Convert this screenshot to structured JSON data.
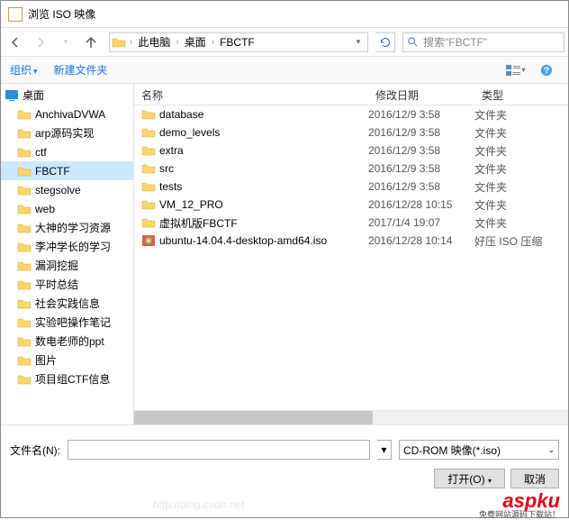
{
  "title": "浏览 ISO 映像",
  "breadcrumb": [
    "此电脑",
    "桌面",
    "FBCTF"
  ],
  "search_placeholder": "搜索\"FBCTF\"",
  "toolbar": {
    "organize": "组织",
    "new_folder": "新建文件夹"
  },
  "tree": {
    "root": "桌面",
    "items": [
      "AnchivaDVWA",
      "arp源码实现",
      "ctf",
      "FBCTF",
      "stegsolve",
      "web",
      "大神的学习资源",
      "李冲学长的学习",
      "漏洞挖掘",
      "平时总结",
      "社会实践信息",
      "实验吧操作笔记",
      "数电老师的ppt",
      "图片",
      "项目组CTF信息"
    ],
    "selected_index": 3
  },
  "file_columns": {
    "name": "名称",
    "date": "修改日期",
    "type": "类型"
  },
  "files": [
    {
      "name": "database",
      "date": "2016/12/9 3:58",
      "type": "文件夹",
      "icon": "folder"
    },
    {
      "name": "demo_levels",
      "date": "2016/12/9 3:58",
      "type": "文件夹",
      "icon": "folder"
    },
    {
      "name": "extra",
      "date": "2016/12/9 3:58",
      "type": "文件夹",
      "icon": "folder"
    },
    {
      "name": "src",
      "date": "2016/12/9 3:58",
      "type": "文件夹",
      "icon": "folder"
    },
    {
      "name": "tests",
      "date": "2016/12/9 3:58",
      "type": "文件夹",
      "icon": "folder"
    },
    {
      "name": "VM_12_PRO",
      "date": "2016/12/28 10:15",
      "type": "文件夹",
      "icon": "folder"
    },
    {
      "name": "虚拟机版FBCTF",
      "date": "2017/1/4 19:07",
      "type": "文件夹",
      "icon": "folder"
    },
    {
      "name": "ubuntu-14.04.4-desktop-amd64.iso",
      "date": "2016/12/28 10:14",
      "type": "好压 ISO 压缩",
      "icon": "iso"
    }
  ],
  "filename_label": "文件名(N):",
  "filename_value": "",
  "filetype_value": "CD-ROM 映像(*.iso)",
  "buttons": {
    "open": "打开(O)",
    "cancel": "取消"
  },
  "watermark": "aspku",
  "watermark_sub": "免费网站源码下载站！",
  "faint_url": "http://blog.csdn.net"
}
